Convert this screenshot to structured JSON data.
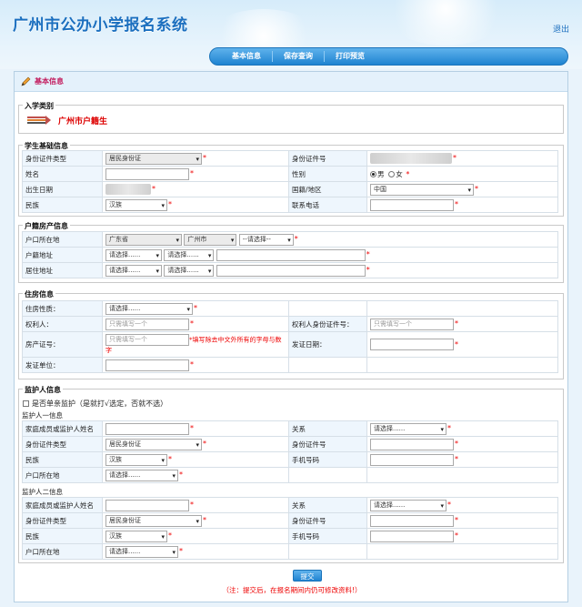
{
  "header": {
    "title": "广州市公办小学报名系统",
    "logout": "退出"
  },
  "nav": [
    "基本信息",
    "保存查询",
    "打印预览"
  ],
  "panel": {
    "label": "基本信息"
  },
  "enroll": {
    "title": "入学类别",
    "type": "广州市户籍生"
  },
  "student": {
    "title": "学生基础信息",
    "id_type_label": "身份证件类型",
    "id_type_value": "居民身份证",
    "id_no_label": "身份证件号",
    "name_label": "姓名",
    "gender_label": "性别",
    "gender_male": "男",
    "gender_female": "女",
    "birth_label": "出生日期",
    "nation_label": "国籍/地区",
    "nation_value": "中国",
    "ethnic_label": "民族",
    "ethnic_value": "汉族",
    "phone_label": "联系电话"
  },
  "household": {
    "title": "户籍房产信息",
    "hukou_label": "户口所在地",
    "province": "广东省",
    "city": "广州市",
    "district": "--请选择--",
    "hukou_addr_label": "户籍地址",
    "select_placeholder": "请选择......",
    "live_addr_label": "居住地址"
  },
  "housing": {
    "title": "住房信息",
    "nature_label": "住房性质：",
    "nature_value": "请选择......",
    "owner_label": "权利人：",
    "owner_placeholder": "只需填写一个",
    "owner_id_label": "权利人身份证件号：",
    "owner_id_placeholder": "只需填写一个",
    "cert_label": "房产证号：",
    "cert_placeholder": "只需填写一个",
    "cert_note": "*填写除去中文外所有的字母与数字",
    "issue_date_label": "发证日期：",
    "issuer_label": "发证单位："
  },
  "guardian": {
    "title": "监护人信息",
    "single_label": "是否单亲监护（是就打√选定，否就不选）",
    "g1_title": "监护人一信息",
    "g2_title": "监护人二信息",
    "name_label": "家庭成员或监护人姓名",
    "relation_label": "关系",
    "relation_value": "请选择......",
    "id_type_label": "身份证件类型",
    "id_type_value": "居民身份证",
    "id_no_label": "身份证件号",
    "ethnic_label": "民族",
    "ethnic_value": "汉族",
    "mobile_label": "手机号码",
    "hukou_label": "户口所在地",
    "hukou_value": "请选择......"
  },
  "submit": {
    "label": "提交",
    "note": "（注：提交后，在报名期间内仍可修改资料!）"
  }
}
